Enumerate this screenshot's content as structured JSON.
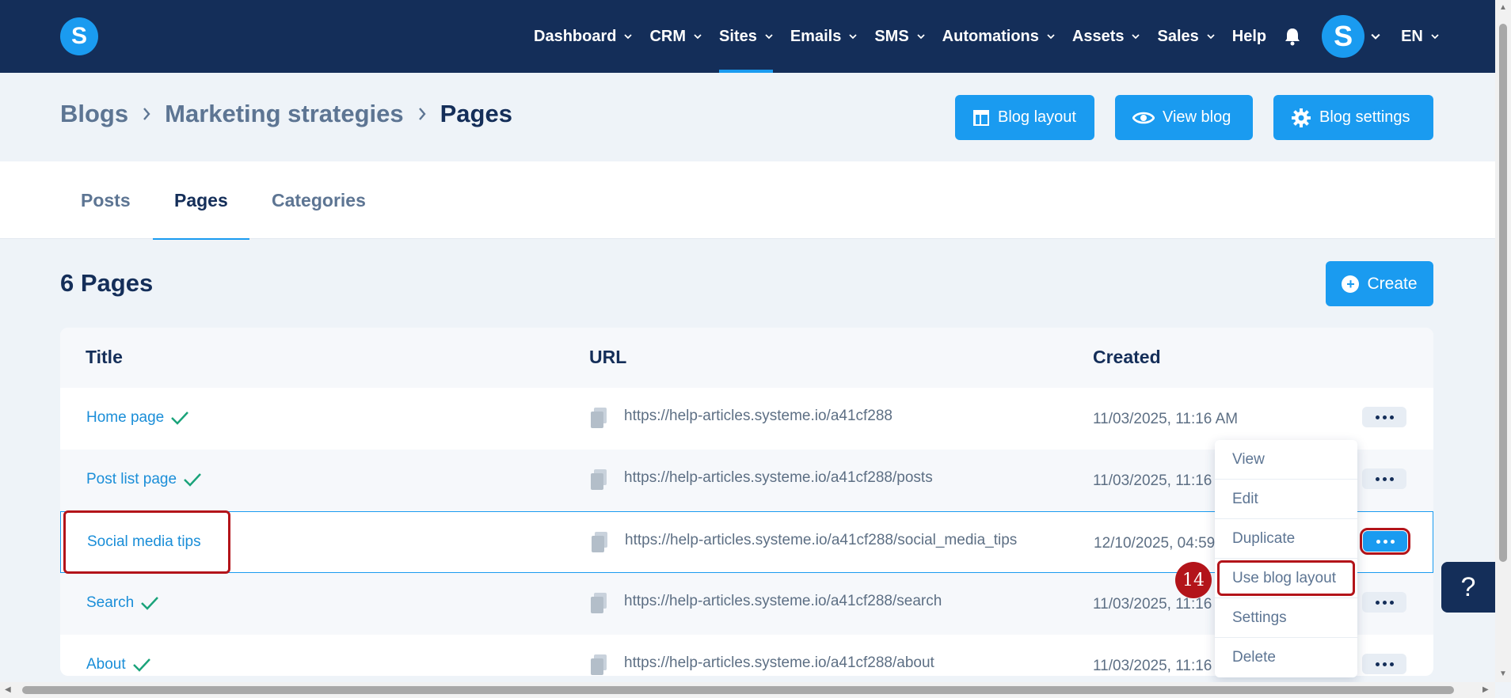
{
  "nav": {
    "logo": "S",
    "items": [
      {
        "label": "Dashboard",
        "dropdown": true
      },
      {
        "label": "CRM",
        "dropdown": true
      },
      {
        "label": "Sites",
        "dropdown": true,
        "active": true
      },
      {
        "label": "Emails",
        "dropdown": true
      },
      {
        "label": "SMS",
        "dropdown": true
      },
      {
        "label": "Automations",
        "dropdown": true
      },
      {
        "label": "Assets",
        "dropdown": true
      },
      {
        "label": "Sales",
        "dropdown": true
      },
      {
        "label": "Help",
        "dropdown": false
      }
    ],
    "avatar": "S",
    "language": "EN"
  },
  "breadcrumb": {
    "blogs": "Blogs",
    "blog": "Marketing strategies",
    "current": "Pages"
  },
  "header_buttons": {
    "blog_layout": "Blog layout",
    "view_blog": "View blog",
    "blog_settings": "Blog settings"
  },
  "tabs": {
    "posts": "Posts",
    "pages": "Pages",
    "categories": "Categories",
    "active": "Pages"
  },
  "count_title": "6 Pages",
  "create_label": "Create",
  "table": {
    "headers": {
      "title": "Title",
      "url": "URL",
      "created": "Created"
    },
    "rows": [
      {
        "title": "Home page",
        "checked": true,
        "url": "https://help-articles.systeme.io/a41cf288",
        "created": "11/03/2025, 11:16 AM"
      },
      {
        "title": "Post list page",
        "checked": true,
        "url": "https://help-articles.systeme.io/a41cf288/posts",
        "created": "11/03/2025, 11:16 A"
      },
      {
        "title": "Social media tips",
        "checked": false,
        "url": "https://help-articles.systeme.io/a41cf288/social_media_tips",
        "created": "12/10/2025, 04:59"
      },
      {
        "title": "Search",
        "checked": true,
        "url": "https://help-articles.systeme.io/a41cf288/search",
        "created": "11/03/2025, 11:16 A"
      },
      {
        "title": "About",
        "checked": true,
        "url": "https://help-articles.systeme.io/a41cf288/about",
        "created": "11/03/2025, 11:16 A"
      }
    ]
  },
  "dropdown": {
    "items": [
      "View",
      "Edit",
      "Duplicate",
      "Use blog layout",
      "Settings",
      "Delete"
    ],
    "highlighted": "Use blog layout"
  },
  "step_badge": "14",
  "help_button": "?",
  "colors": {
    "navy": "#142e59",
    "accent": "#1a9bf0",
    "highlight": "#b3141a",
    "success": "#1aa37a"
  }
}
